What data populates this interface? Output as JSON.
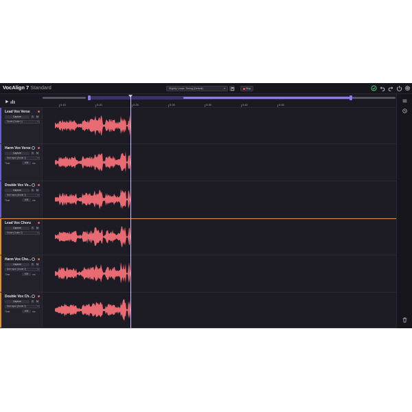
{
  "app": {
    "name": "VocAlign 7",
    "edition": "Standard"
  },
  "header": {
    "preset": "Slightly Loose: Timing (Default)",
    "stop_label": "Stop"
  },
  "ruler": {
    "ticks": [
      "0:15",
      "0:20",
      "0:25",
      "0:30",
      "0:35",
      "0:40",
      "0:45"
    ]
  },
  "tracks": [
    {
      "name": "Lead Vox Verse",
      "capture": "Capture",
      "solo": "S",
      "mute": "M",
      "guide": "Guide (Guide 1)",
      "time_label": "",
      "time_value": "",
      "time_unit": "",
      "accent": "#6b5fd0"
    },
    {
      "name": "Harm Vox Verse",
      "capture": "Capture",
      "solo": "S",
      "mute": "M",
      "guide": "Dub Input (Guide 1)",
      "time_label": "Time",
      "time_value": "100",
      "time_unit": "ms",
      "accent": "#6b5fd0"
    },
    {
      "name": "Double Vox Ve...",
      "capture": "Capture",
      "solo": "S",
      "mute": "M",
      "guide": "Dub Input (Guide 1)",
      "time_label": "Time",
      "time_value": "100",
      "time_unit": "ms",
      "accent": "#6b5fd0"
    },
    {
      "name": "Lead Vox Chorus",
      "capture": "Capture",
      "solo": "S",
      "mute": "M",
      "guide": "Guide (Guide 2)",
      "time_label": "",
      "time_value": "",
      "time_unit": "",
      "accent": "#d9913a"
    },
    {
      "name": "Harm Vox Cho...",
      "capture": "Capture",
      "solo": "S",
      "mute": "M",
      "guide": "Dub Input (Guide 2)",
      "time_label": "Time",
      "time_value": "100",
      "time_unit": "ms",
      "accent": "#d9913a"
    },
    {
      "name": "Double Vox Ch...",
      "capture": "Capture",
      "solo": "S",
      "mute": "M",
      "guide": "Dub Input (Guide 2)",
      "time_label": "Time",
      "time_value": "100",
      "time_unit": "ms",
      "accent": "#d9913a"
    }
  ],
  "colors": {
    "background": "#1b1a22",
    "waveform": "#e86a73",
    "accent_purple": "#8b7be3",
    "accent_orange": "#d9913a",
    "record": "#e45c6a",
    "status_ok": "#3fbf6f"
  },
  "icons": {
    "header": [
      "check-circle-icon",
      "undo-icon",
      "redo-icon",
      "power-icon",
      "settings-icon"
    ],
    "toolbar": [
      "play-icon",
      "levels-icon"
    ],
    "rail": [
      "list-icon",
      "history-icon",
      "trash-icon"
    ]
  }
}
